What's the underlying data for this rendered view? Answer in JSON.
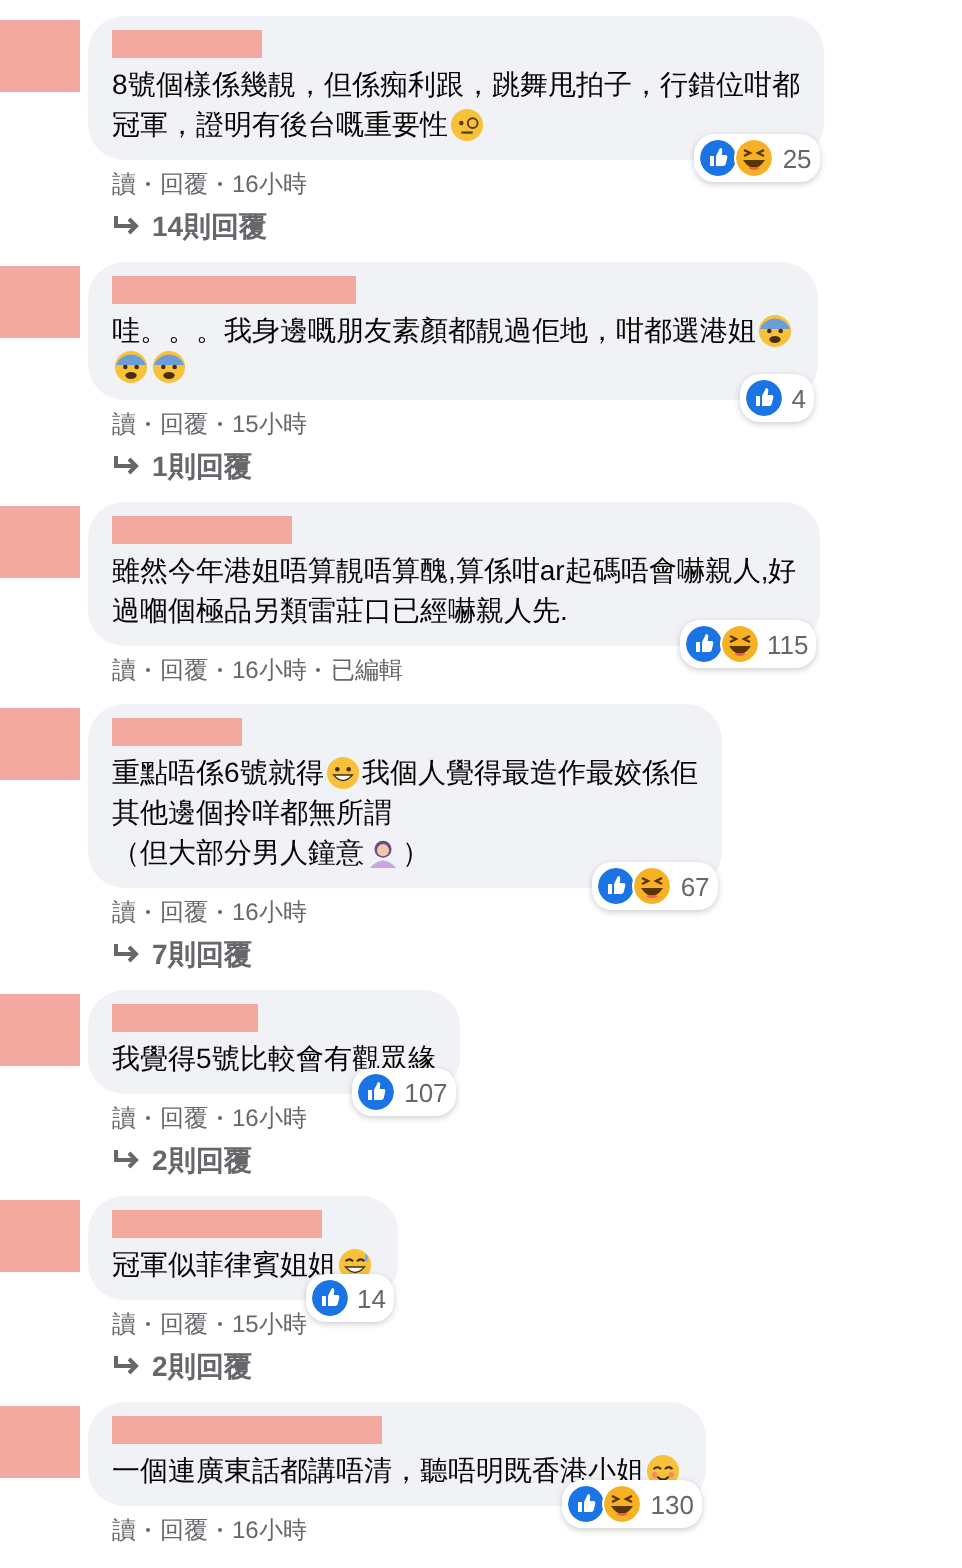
{
  "comments": [
    {
      "lines": [
        [
          {
            "kind": "text",
            "text": "8號個樣係幾靚，但係痴利跟，跳舞甩拍子，行錯位咁都"
          }
        ],
        [
          {
            "kind": "text",
            "text": "冠軍，證明有後台嘅重要性"
          },
          {
            "kind": "monocle"
          }
        ]
      ],
      "reactions": [
        {
          "kind": "like"
        },
        {
          "kind": "haha"
        }
      ],
      "count": "25",
      "meta": [
        "讀",
        "回覆",
        "16小時"
      ],
      "replies": "14則回覆"
    },
    {
      "lines": [
        [
          {
            "kind": "text",
            "text": "哇。。。我身邊嘅朋友素顏都靚過佢地，咁都選港姐"
          },
          {
            "kind": "fearful"
          }
        ],
        [
          {
            "kind": "fearful"
          },
          {
            "kind": "fearful"
          }
        ]
      ],
      "reactions": [
        {
          "kind": "like"
        }
      ],
      "count": "4",
      "meta": [
        "讀",
        "回覆",
        "15小時"
      ],
      "replies": "1則回覆"
    },
    {
      "lines": [
        [
          {
            "kind": "text",
            "text": "雖然今年港姐唔算靚唔算醜,算係咁ar起碼唔會嚇親人,好"
          }
        ],
        [
          {
            "kind": "text",
            "text": "過嗰個極品另類雷莊口已經嚇親人先."
          }
        ]
      ],
      "reactions": [
        {
          "kind": "like"
        },
        {
          "kind": "haha"
        }
      ],
      "count": "115",
      "meta": [
        "讀",
        "回覆",
        "16小時",
        "已編輯"
      ]
    },
    {
      "lines": [
        [
          {
            "kind": "text",
            "text": "重點唔係6號就得"
          },
          {
            "kind": "grin"
          },
          {
            "kind": "text",
            "text": " 我個人覺得最造作最姣係佢"
          }
        ],
        [
          {
            "kind": "text",
            "text": "其他邊個拎咩都無所謂"
          }
        ],
        [
          {
            "kind": "text",
            "text": "（但大部分男人鐘意"
          },
          {
            "kind": "shrug"
          },
          {
            "kind": "text",
            "text": "）"
          }
        ]
      ],
      "reactions": [
        {
          "kind": "like"
        },
        {
          "kind": "haha"
        }
      ],
      "count": "67",
      "meta": [
        "讀",
        "回覆",
        "16小時"
      ],
      "replies": "7則回覆"
    },
    {
      "lines": [
        [
          {
            "kind": "text",
            "text": "我覺得5號比較會有觀眾緣"
          }
        ]
      ],
      "reactions": [
        {
          "kind": "like"
        }
      ],
      "count": "107",
      "meta": [
        "讀",
        "回覆",
        "16小時"
      ],
      "replies": "2則回覆"
    },
    {
      "lines": [
        [
          {
            "kind": "text",
            "text": "冠軍似菲律賓姐姐"
          },
          {
            "kind": "sweat"
          }
        ]
      ],
      "reactions": [
        {
          "kind": "like"
        }
      ],
      "count": "14",
      "meta": [
        "讀",
        "回覆",
        "15小時"
      ],
      "replies": "2則回覆"
    },
    {
      "lines": [
        [
          {
            "kind": "text",
            "text": "一個連廣東話都講唔清，聽唔明既香港小姐"
          },
          {
            "kind": "smiling"
          }
        ]
      ],
      "reactions": [
        {
          "kind": "like"
        },
        {
          "kind": "haha"
        }
      ],
      "count": "130",
      "meta": [
        "讀",
        "回覆",
        "16小時"
      ]
    }
  ]
}
